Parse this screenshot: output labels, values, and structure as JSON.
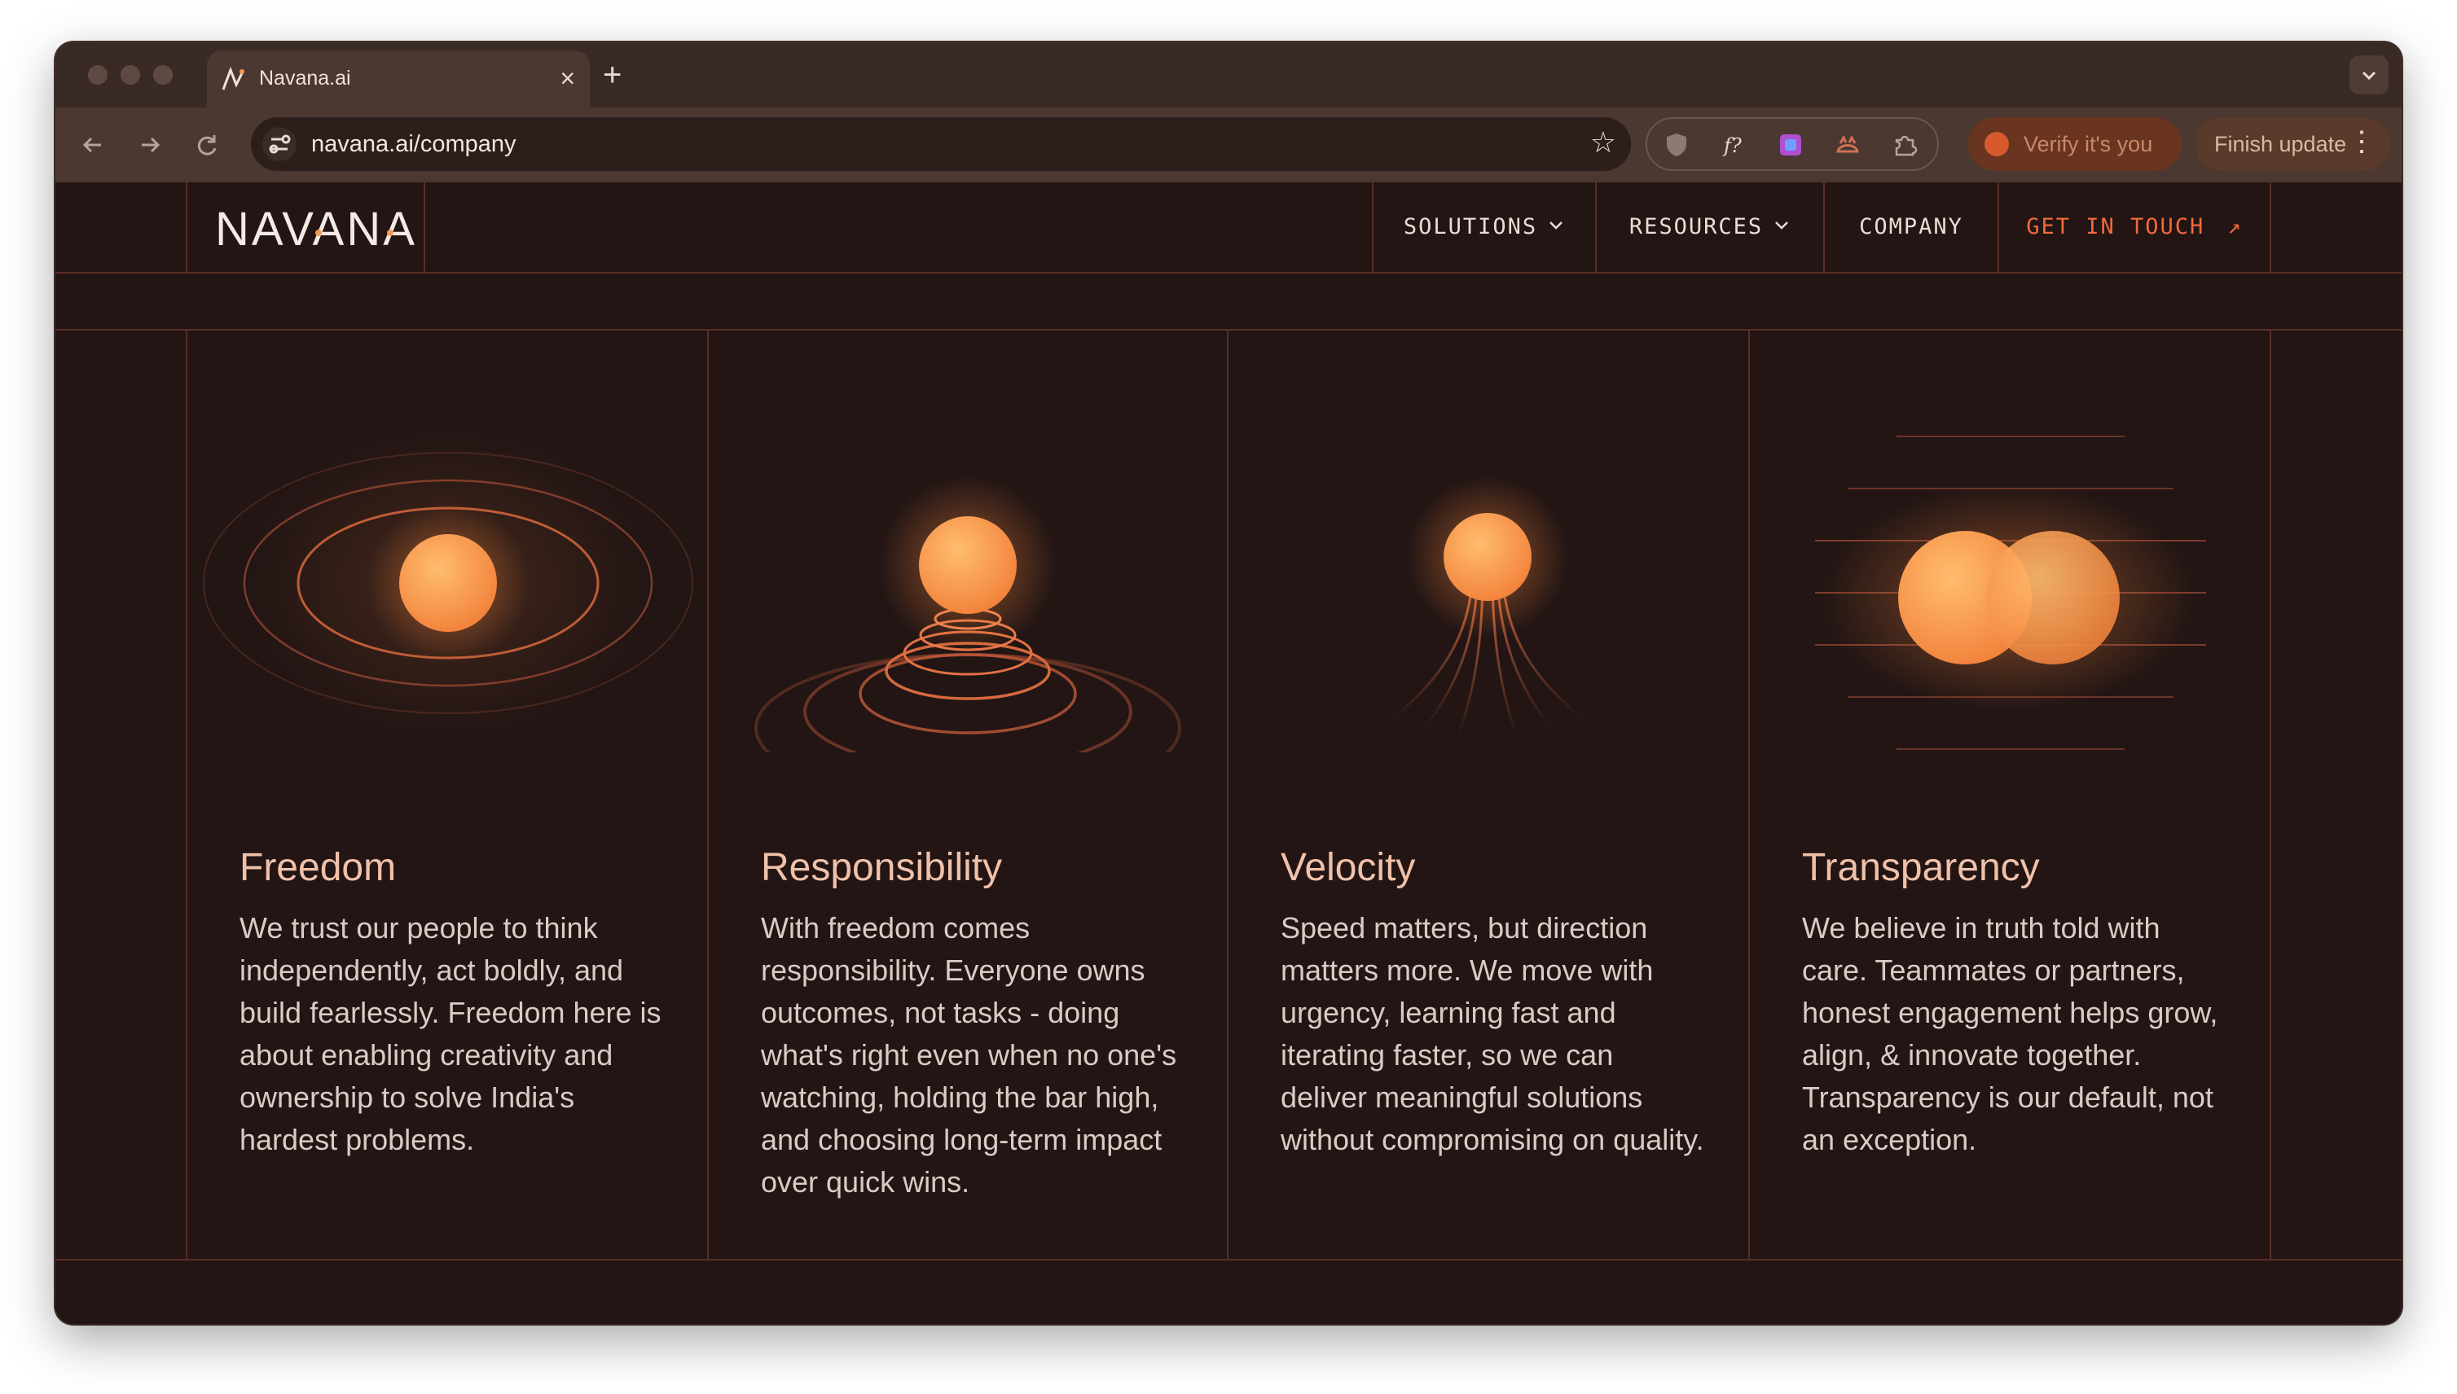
{
  "browser": {
    "tab": {
      "title": "Navana.ai",
      "close": "×"
    },
    "new_tab": "+",
    "url": "navana.ai/company",
    "verify_label": "Verify it's you",
    "finish_label": "Finish update",
    "icons": [
      "back-icon",
      "forward-icon",
      "reload-icon",
      "site-settings-icon",
      "star-icon",
      "shield-icon",
      "fx-icon",
      "extension-icon",
      "puzzle-icon",
      "menu-icon"
    ]
  },
  "site": {
    "logo": "NAVANA",
    "nav": {
      "solutions": "SOLUTIONS",
      "resources": "RESOURCES",
      "company": "COMPANY",
      "cta": "GET IN TOUCH",
      "cta_arrow": "↗",
      "chevron": "⌄"
    },
    "values": [
      {
        "title": "Freedom",
        "desc": "We trust our people to think independently, act boldly, and build fearlessly. Freedom here is about enabling creativity and ownership to solve India's hardest problems."
      },
      {
        "title": "Responsibility",
        "desc": "With freedom comes responsibility. Everyone owns outcomes, not tasks - doing what's right even when no one's watching, holding the bar high, and choosing long-term impact over quick wins."
      },
      {
        "title": "Velocity",
        "desc": "Speed matters, but direction matters more. We move with urgency, learning fast and iterating faster, so we can deliver meaningful solutions without compromising on quality."
      },
      {
        "title": "Transparency",
        "desc": "We believe in truth told with care. Teammates or partners, honest engagement helps grow, align, & innovate together. Transparency is our default, not an exception."
      }
    ]
  },
  "colors": {
    "bg": "#221514",
    "line": "#5a2e28",
    "accent": "#f06a3e",
    "orb": "#f7a255"
  }
}
